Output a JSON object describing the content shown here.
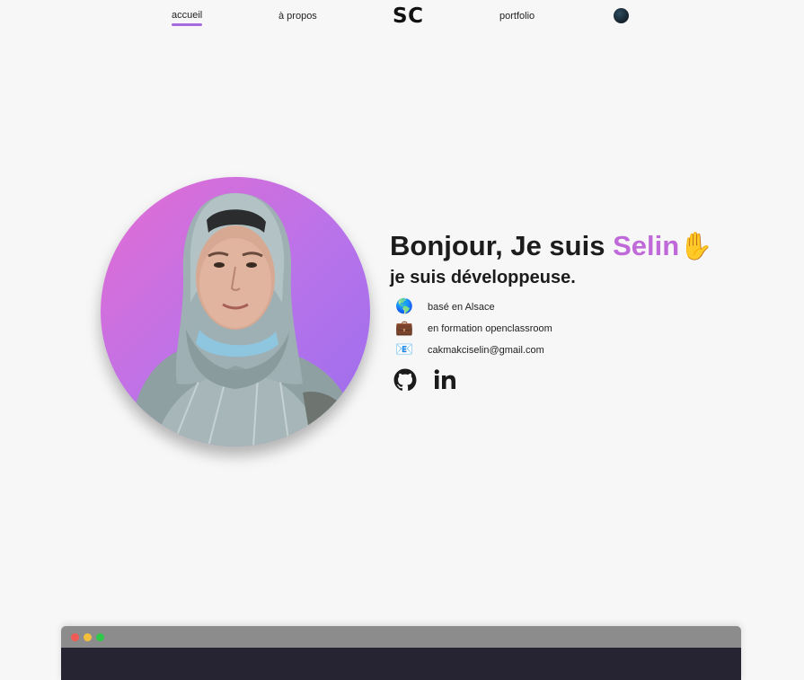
{
  "nav": {
    "home": "accueil",
    "about": "à propos",
    "logo": "SC",
    "portfolio": "portfolio"
  },
  "hero": {
    "greeting_prefix": "Bonjour, Je suis ",
    "name": "Selin",
    "wave": "✋",
    "subtitle": "je suis développeuse.",
    "info": [
      {
        "icon": "globe-icon",
        "glyph": "🌎",
        "text": "basé en Alsace"
      },
      {
        "icon": "briefcase-icon",
        "glyph": "💼",
        "text": "en formation openclassroom"
      },
      {
        "icon": "email-icon",
        "glyph": "📧",
        "text": "cakmakciselin@gmail.com"
      }
    ],
    "socials": [
      {
        "icon": "github-icon"
      },
      {
        "icon": "linkedin-icon"
      }
    ]
  },
  "colors": {
    "accent": "#c069d9",
    "underline": "#a66be0",
    "background": "#f7f7f7",
    "window_bar": "#8c8c8c",
    "window_body": "#262332"
  }
}
